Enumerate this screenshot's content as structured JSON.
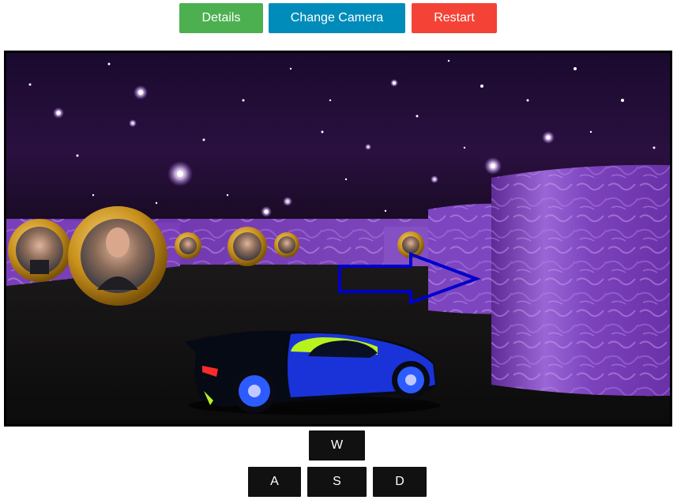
{
  "toolbar": {
    "details_label": "Details",
    "camera_label": "Change Camera",
    "restart_label": "Restart"
  },
  "colors": {
    "details": "#4caf50",
    "camera": "#008cba",
    "restart": "#f44336",
    "key_bg": "#111111",
    "arrow": "#0000cc",
    "wall": "#7a3fb8",
    "frame": "#d4a017",
    "car_body": "#1a33d9",
    "car_dark": "#050a14",
    "car_accent": "#b7f21e"
  },
  "scene": {
    "description_icons": [
      "space-skybox",
      "purple-wall",
      "portrait-coin",
      "direction-arrow",
      "sports-car"
    ]
  },
  "controls": {
    "forward": "W",
    "left": "A",
    "back": "S",
    "right": "D"
  }
}
